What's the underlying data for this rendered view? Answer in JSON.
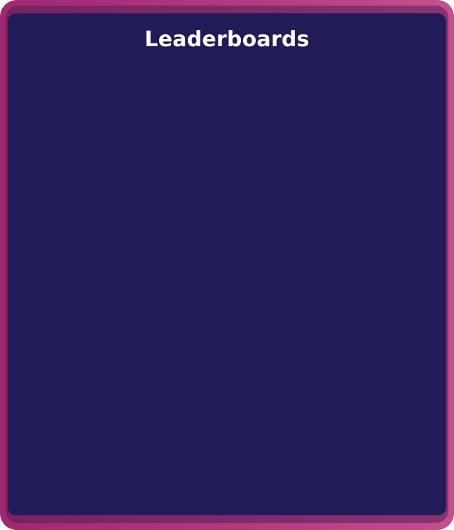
{
  "leaderboard": {
    "title": "Leaderboards",
    "entries": []
  },
  "colors": {
    "frame_gradient_start": "#a0286e",
    "frame_gradient_end": "#c4508e",
    "panel_background": "#211c58",
    "title_text": "#ffffff"
  }
}
